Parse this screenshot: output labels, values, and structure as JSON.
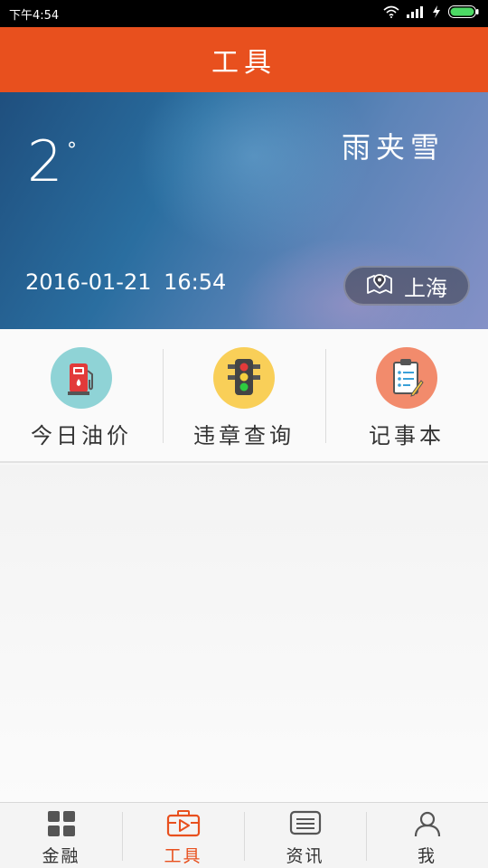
{
  "status_bar": {
    "time": "下午4:54",
    "icons": [
      "wifi-icon",
      "signal-icon",
      "charging-icon",
      "battery-icon"
    ]
  },
  "header": {
    "title": "工具"
  },
  "weather": {
    "temperature": "2",
    "unit": "°",
    "condition": "雨夹雪",
    "date": "2016-01-21",
    "time": "16:54",
    "location": "上海"
  },
  "tools": [
    {
      "label": "今日油价",
      "icon": "fuel-pump-icon",
      "bg": "#8fd3d6"
    },
    {
      "label": "违章查询",
      "icon": "traffic-light-icon",
      "bg": "#f9cf58"
    },
    {
      "label": "记事本",
      "icon": "clipboard-icon",
      "bg": "#f28b6c"
    }
  ],
  "tabs": [
    {
      "label": "金融",
      "icon": "grid-icon",
      "active": false
    },
    {
      "label": "工具",
      "icon": "toolbox-icon",
      "active": true
    },
    {
      "label": "资讯",
      "icon": "news-icon",
      "active": false
    },
    {
      "label": "我",
      "icon": "user-icon",
      "active": false
    }
  ],
  "colors": {
    "accent": "#e8501e",
    "status_bar": "#000000",
    "battery_level": "#4cd964"
  }
}
